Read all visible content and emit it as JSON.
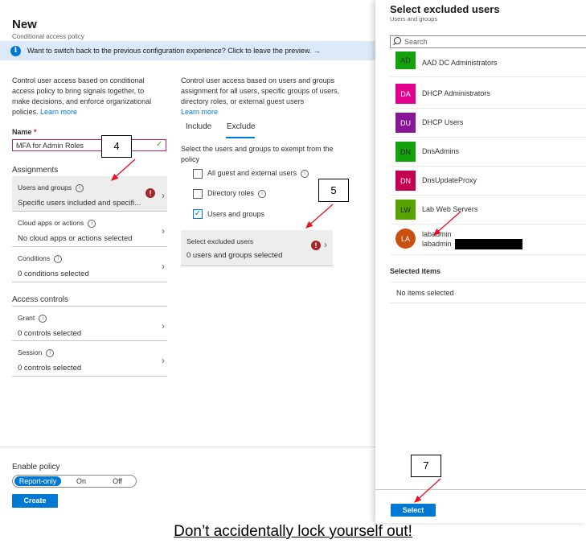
{
  "header": {
    "title": "New",
    "subtitle": "Conditional access policy"
  },
  "banner": {
    "icon": "info-icon",
    "text": "Want to switch back to the previous configuration experience? Click to leave the preview. →"
  },
  "left": {
    "description": "Control user access based on conditional access policy to bring signals together, to make decisions, and enforce organizational policies.",
    "learn_more": "Learn more",
    "name_label": "Name",
    "name_required": "*",
    "name_value": "MFA for Admin Roles",
    "assignments_title": "Assignments",
    "rows": [
      {
        "title": "Users and groups",
        "value": "Specific users included and specifi...",
        "error": "!"
      },
      {
        "title": "Cloud apps or actions",
        "value": "No cloud apps or actions selected"
      },
      {
        "title": "Conditions",
        "value": "0 conditions selected"
      }
    ],
    "access_controls_title": "Access controls",
    "access_rows": [
      {
        "title": "Grant",
        "value": "0 controls selected"
      },
      {
        "title": "Session",
        "value": "0 controls selected"
      }
    ]
  },
  "middle": {
    "description": "Control user access based on users and groups assignment for all users, specific groups of users, directory roles, or external guest users",
    "learn_more": "Learn more",
    "tabs": [
      "Include",
      "Exclude"
    ],
    "active_tab": "Exclude",
    "exclude_prompt": "Select the users and groups to exempt from the policy",
    "options": [
      {
        "label": "All guest and external users",
        "checked": false,
        "info": true
      },
      {
        "label": "Directory roles",
        "checked": false,
        "info": true
      },
      {
        "label": "Users and groups",
        "checked": true,
        "info": false
      }
    ],
    "select_row": {
      "title": "Select excluded users",
      "value": "0 users and groups selected",
      "error": "!"
    }
  },
  "policy": {
    "enable_label": "Enable policy",
    "options": [
      "Report-only",
      "On",
      "Off"
    ],
    "selected": "Report-only",
    "create_label": "Create"
  },
  "panel": {
    "title": "Select excluded users",
    "subtitle": "Users and groups",
    "search_placeholder": "Search",
    "items": [
      {
        "initials": "AD",
        "name": "AAD DC Administrators",
        "color": "#13a10e"
      },
      {
        "initials": "DA",
        "name": "DHCP Administrators",
        "color": "#e3008c"
      },
      {
        "initials": "DU",
        "name": "DHCP Users",
        "color": "#881798"
      },
      {
        "initials": "DN",
        "name": "DnsAdmins",
        "color": "#107c10"
      },
      {
        "initials": "DN",
        "name": "DnsUpdateProxy",
        "color": "#c30052"
      },
      {
        "initials": "LW",
        "name": "Lab Web Servers",
        "color": "#57a300"
      },
      {
        "initials": "LA",
        "name": "labadmin",
        "email": "labadmin",
        "color": "#ca5010"
      }
    ],
    "selected_heading": "Selected items",
    "no_items": "No items selected",
    "select_label": "Select"
  },
  "annotations": {
    "step_4": "4",
    "step_5": "5",
    "step_7": "7"
  },
  "caption": "Don’t accidentally lock yourself out!",
  "colors": {
    "accent": "#0078d4",
    "error": "#a4262c",
    "annotation_arrow": "#e81123"
  }
}
